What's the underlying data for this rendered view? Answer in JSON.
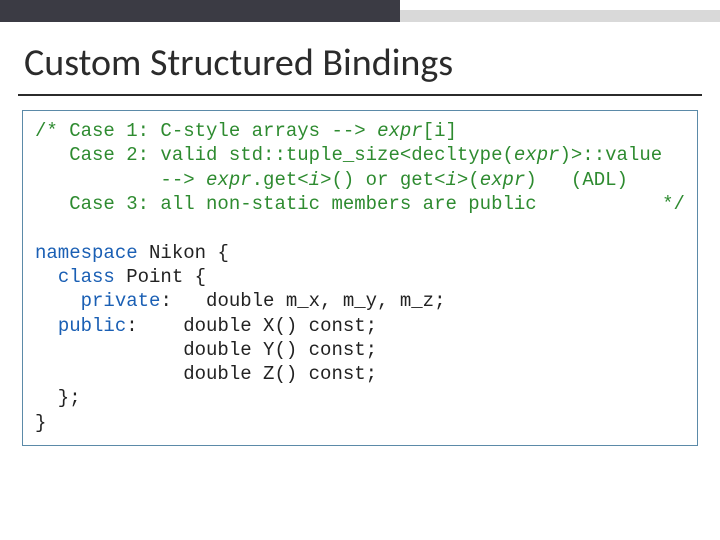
{
  "title": "Custom Structured Bindings",
  "code": {
    "c1a": "/* Case 1: C-style arrays --> ",
    "c1b": "expr",
    "c1c": "[i]",
    "c2a": "   Case 2: valid std::tuple_size<decltype(",
    "c2b": "expr",
    "c2c": ")>::value",
    "c3a": "           --> ",
    "c3b": "expr",
    "c3c": ".get<",
    "c3d": "i",
    "c3e": ">() or get<",
    "c3f": "i",
    "c3g": ">(",
    "c3h": "expr",
    "c3i": ")   (ADL)",
    "c4": "   Case 3: all non-static members are public           */",
    "blank": " ",
    "l1a": "namespace",
    "l1b": " Nikon {",
    "l2a": "  ",
    "l2b": "class",
    "l2c": " Point {",
    "l3a": "    ",
    "l3b": "private",
    "l3c": ":   double m_x, m_y, m_z;",
    "l4a": "  ",
    "l4b": "public",
    "l4c": ":    double X() const;",
    "l5": "             double Y() const;",
    "l6": "             double Z() const;",
    "l7": "  };",
    "l8": "}"
  }
}
